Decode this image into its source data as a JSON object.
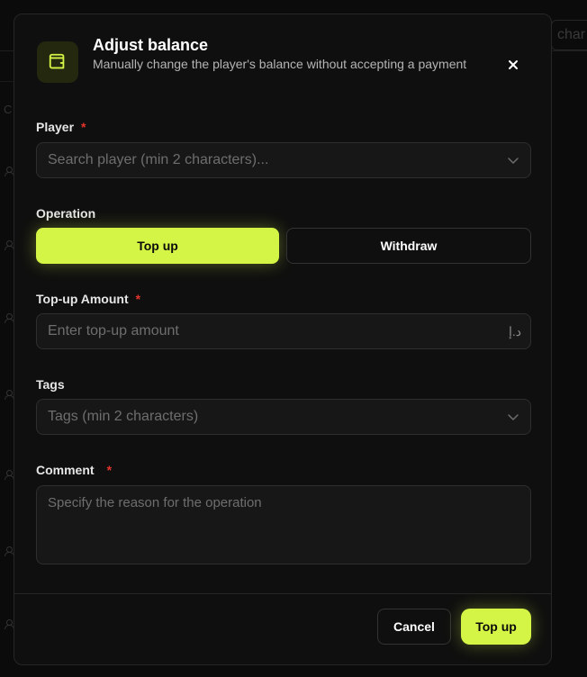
{
  "background": {
    "search_fragment": "char",
    "column_letter": "C"
  },
  "modal": {
    "icon": "wallet-icon",
    "title": "Adjust balance",
    "subtitle": "Manually change the player's balance without accepting a payment",
    "close_icon": "close-icon"
  },
  "form": {
    "player": {
      "label": "Player",
      "required_mark": "*",
      "placeholder": "Search player (min 2 characters)..."
    },
    "operation": {
      "label": "Operation",
      "options": [
        "Top up",
        "Withdraw"
      ],
      "selected": "Top up"
    },
    "amount": {
      "label": "Top-up Amount",
      "required_mark": "*",
      "placeholder": "Enter top-up amount",
      "currency": "د.إ"
    },
    "tags": {
      "label": "Tags",
      "placeholder": "Tags (min 2 characters)"
    },
    "comment": {
      "label": "Comment",
      "required_mark": "*",
      "placeholder": "Specify the reason for the operation"
    }
  },
  "footer": {
    "cancel_label": "Cancel",
    "submit_label": "Top up"
  },
  "colors": {
    "accent": "#d4f545",
    "required": "#e5342b",
    "modal_bg": "#0f0f0f",
    "field_bg": "#171717"
  }
}
